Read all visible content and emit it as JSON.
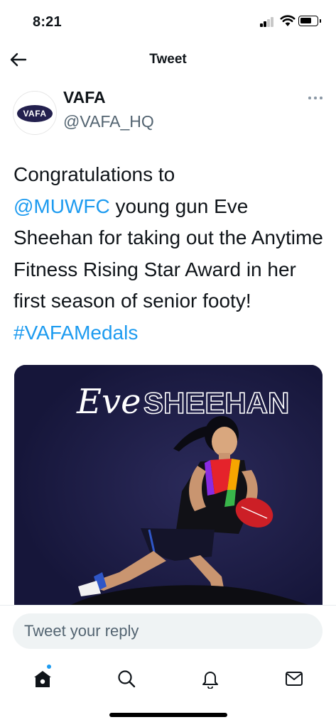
{
  "status_bar": {
    "time": "8:21"
  },
  "nav": {
    "title": "Tweet"
  },
  "tweet": {
    "author_name": "VAFA",
    "author_handle": "@VAFA_HQ",
    "avatar_logo_text": "VAFA",
    "text_1": "Congratulations to",
    "mention": "@MUWFC",
    "text_2": " young gun Eve Sheehan for taking out the Anytime Fitness Rising Star Award in her first season of senior footy! ",
    "hashtag": "#VAFAMedals"
  },
  "media": {
    "script_text": "Eve",
    "block_text": "SHEEHAN"
  },
  "reply": {
    "placeholder": "Tweet your reply"
  },
  "tabbar": {
    "items": [
      "home-icon",
      "search-icon",
      "notifications-icon",
      "messages-icon"
    ],
    "home_has_badge": true
  },
  "colors": {
    "accent": "#1d9bf0",
    "text": "#0f1419",
    "secondary": "#536471",
    "media_bg": "#1c1c3d"
  }
}
